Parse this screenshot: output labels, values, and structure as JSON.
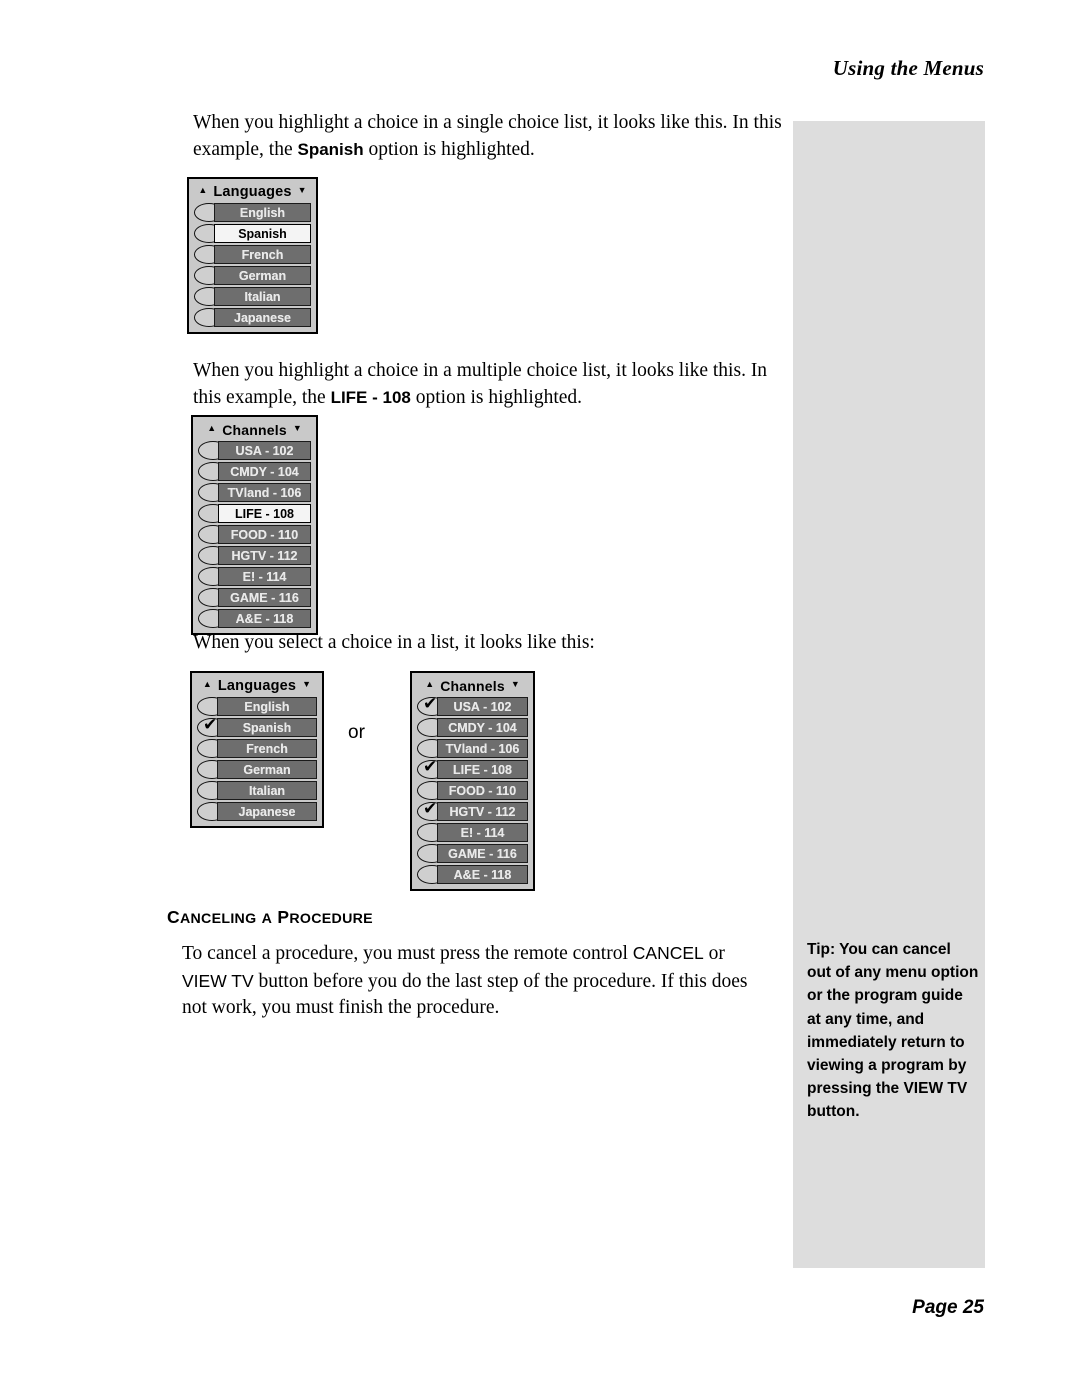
{
  "running_head": "Using the Menus",
  "page_footer": "Page 25",
  "paragraphs": {
    "p1_a": "When you highlight a choice in a single choice list, it looks like this. In this example, the ",
    "p1_b": "Spanish",
    "p1_c": " option is highlighted.",
    "p2_a": "When you highlight a choice in a multiple choice list, it looks like this. In this example, the ",
    "p2_b": "LIFE - 108",
    "p2_c": " option is highlighted.",
    "p3": "When you select a choice in a list, it looks like this:",
    "p4_a": "To cancel a procedure, you must press the remote control ",
    "p4_b": "CANCEL",
    "p4_c": " or ",
    "p4_d": "VIEW TV",
    "p4_e": " button before you do the last step of the procedure. If this does not work, you must finish the procedure."
  },
  "section_heading": {
    "word1_first": "C",
    "word1_rest": "ANCELING",
    "word2": "A",
    "word3_first": "P",
    "word3_rest": "ROCEDURE"
  },
  "or_label": "or",
  "tip": {
    "text": "Tip: You can cancel out of any menu option or the program guide at any time, and immediately return to viewing a program by pressing the VIEW TV button."
  },
  "icons": {
    "scroll_up": "▲",
    "scroll_down": "▼",
    "checkmark": "✔"
  },
  "colors": {
    "page_background": "#ffffff",
    "tip_band": "#dddddd",
    "widget_frame": "#c9c9c9",
    "widget_border": "#000000",
    "button_fill": "#6e6e6e",
    "button_text": "#e9e9e9",
    "button_highlight_fill": "#f4f4f4",
    "button_highlight_text": "#000000",
    "bullet_fill": "#cfcfcf"
  },
  "widgets": {
    "languages_highlight": {
      "title": "Languages",
      "rows": [
        {
          "label": "English",
          "highlight": false,
          "checked": false
        },
        {
          "label": "Spanish",
          "highlight": true,
          "checked": false
        },
        {
          "label": "French",
          "highlight": false,
          "checked": false
        },
        {
          "label": "German",
          "highlight": false,
          "checked": false
        },
        {
          "label": "Italian",
          "highlight": false,
          "checked": false
        },
        {
          "label": "Japanese",
          "highlight": false,
          "checked": false
        }
      ]
    },
    "channels_highlight": {
      "title": "Channels",
      "rows": [
        {
          "label": "USA - 102",
          "highlight": false,
          "checked": false
        },
        {
          "label": "CMDY - 104",
          "highlight": false,
          "checked": false
        },
        {
          "label": "TVland - 106",
          "highlight": false,
          "checked": false
        },
        {
          "label": "LIFE - 108",
          "highlight": true,
          "checked": false
        },
        {
          "label": "FOOD - 110",
          "highlight": false,
          "checked": false
        },
        {
          "label": "HGTV - 112",
          "highlight": false,
          "checked": false
        },
        {
          "label": "E! - 114",
          "highlight": false,
          "checked": false
        },
        {
          "label": "GAME - 116",
          "highlight": false,
          "checked": false
        },
        {
          "label": "A&E - 118",
          "highlight": false,
          "checked": false
        }
      ]
    },
    "languages_selected": {
      "title": "Languages",
      "rows": [
        {
          "label": "English",
          "highlight": false,
          "checked": false
        },
        {
          "label": "Spanish",
          "highlight": false,
          "checked": true
        },
        {
          "label": "French",
          "highlight": false,
          "checked": false
        },
        {
          "label": "German",
          "highlight": false,
          "checked": false
        },
        {
          "label": "Italian",
          "highlight": false,
          "checked": false
        },
        {
          "label": "Japanese",
          "highlight": false,
          "checked": false
        }
      ]
    },
    "channels_selected": {
      "title": "Channels",
      "rows": [
        {
          "label": "USA - 102",
          "highlight": false,
          "checked": true
        },
        {
          "label": "CMDY - 104",
          "highlight": false,
          "checked": false
        },
        {
          "label": "TVland - 106",
          "highlight": false,
          "checked": false
        },
        {
          "label": "LIFE - 108",
          "highlight": false,
          "checked": true
        },
        {
          "label": "FOOD - 110",
          "highlight": false,
          "checked": false
        },
        {
          "label": "HGTV - 112",
          "highlight": false,
          "checked": true
        },
        {
          "label": "E! - 114",
          "highlight": false,
          "checked": false
        },
        {
          "label": "GAME - 116",
          "highlight": false,
          "checked": false
        },
        {
          "label": "A&E - 118",
          "highlight": false,
          "checked": false
        }
      ]
    }
  }
}
